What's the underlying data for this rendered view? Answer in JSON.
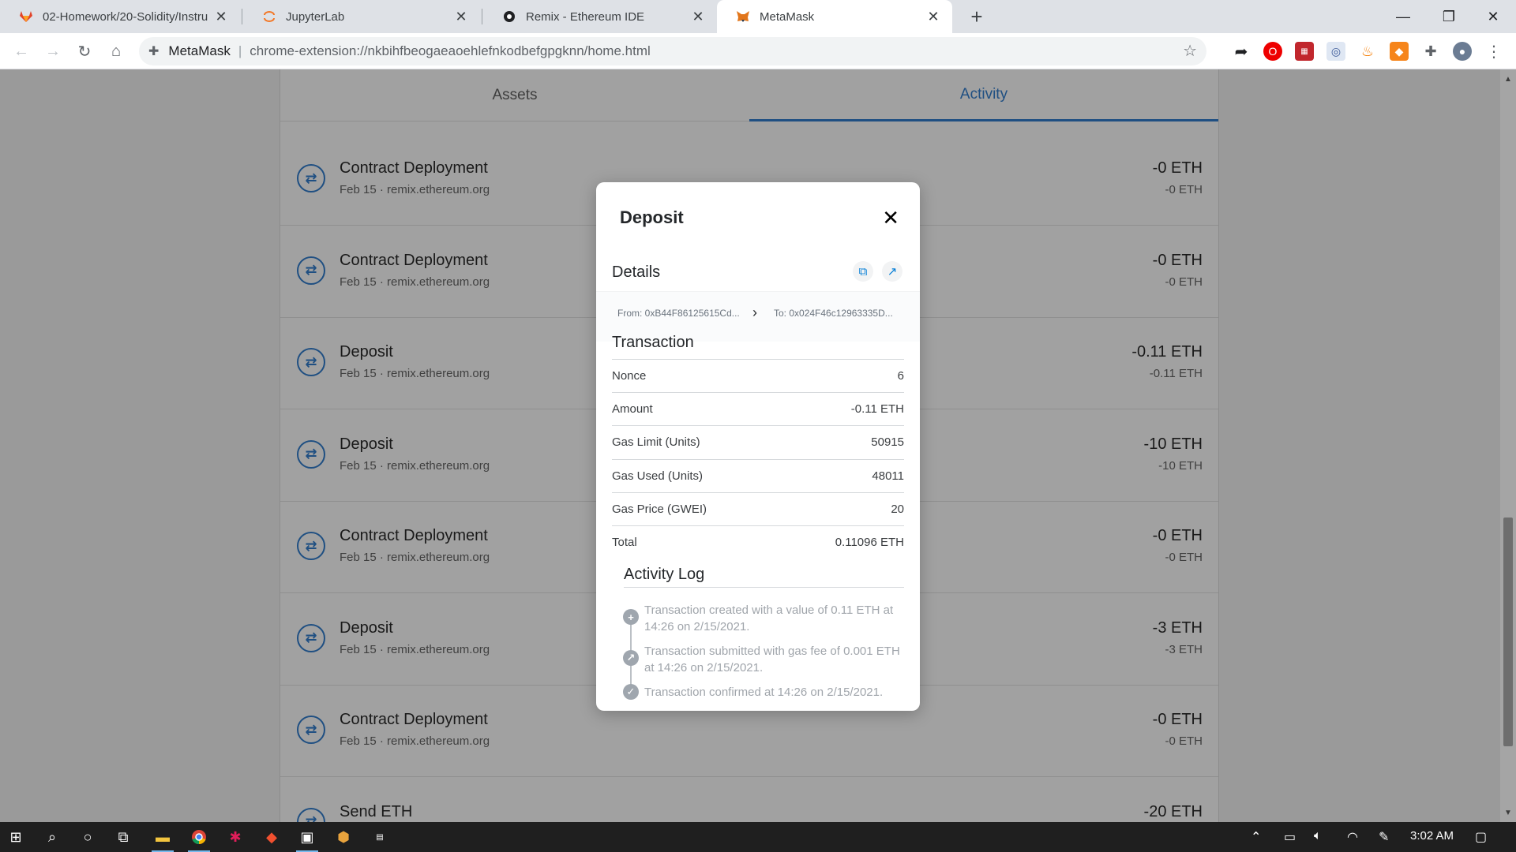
{
  "browser": {
    "tabs": [
      {
        "title": "02-Homework/20-Solidity/Instru",
        "favicon": "gitlab-icon",
        "active": false
      },
      {
        "title": "JupyterLab",
        "favicon": "jupyter-icon",
        "active": false
      },
      {
        "title": "Remix - Ethereum IDE",
        "favicon": "remix-icon",
        "active": false
      },
      {
        "title": "MetaMask",
        "favicon": "metamask-fox-icon",
        "active": true
      }
    ],
    "origin": "MetaMask",
    "url": "chrome-extension://nkbihfbeogaeaoehlefnkodbefgpgknn/home.html"
  },
  "wallet": {
    "tabs": [
      "Assets",
      "Activity"
    ],
    "active_tab": "Activity",
    "transactions": [
      {
        "title": "Contract Deployment",
        "date": "Feb 15",
        "origin": "remix.ethereum.org",
        "amount": "-0 ETH",
        "fiat": "-0 ETH"
      },
      {
        "title": "Contract Deployment",
        "date": "Feb 15",
        "origin": "remix.ethereum.org",
        "amount": "-0 ETH",
        "fiat": "-0 ETH"
      },
      {
        "title": "Deposit",
        "date": "Feb 15",
        "origin": "remix.ethereum.org",
        "amount": "-0.11 ETH",
        "fiat": "-0.11 ETH"
      },
      {
        "title": "Deposit",
        "date": "Feb 15",
        "origin": "remix.ethereum.org",
        "amount": "-10 ETH",
        "fiat": "-10 ETH"
      },
      {
        "title": "Contract Deployment",
        "date": "Feb 15",
        "origin": "remix.ethereum.org",
        "amount": "-0 ETH",
        "fiat": "-0 ETH"
      },
      {
        "title": "Deposit",
        "date": "Feb 15",
        "origin": "remix.ethereum.org",
        "amount": "-3 ETH",
        "fiat": "-3 ETH"
      },
      {
        "title": "Contract Deployment",
        "date": "Feb 15",
        "origin": "remix.ethereum.org",
        "amount": "-0 ETH",
        "fiat": "-0 ETH"
      },
      {
        "title": "Send ETH",
        "date": "",
        "origin": "",
        "amount": "-20 ETH",
        "fiat": ""
      }
    ],
    "separator": "·"
  },
  "modal": {
    "title": "Deposit",
    "details_label": "Details",
    "from": "From: 0xB44F86125615Cd...",
    "to": "To: 0x024F46c12963335D...",
    "transaction_label": "Transaction",
    "rows": [
      {
        "label": "Nonce",
        "value": "6"
      },
      {
        "label": "Amount",
        "value": "-0.11 ETH"
      },
      {
        "label": "Gas Limit (Units)",
        "value": "50915"
      },
      {
        "label": "Gas Used (Units)",
        "value": "48011"
      },
      {
        "label": "Gas Price (GWEI)",
        "value": "20"
      },
      {
        "label": "Total",
        "value": "0.11096 ETH"
      }
    ],
    "activity_log_label": "Activity Log",
    "log": [
      "Transaction created with a value of 0.11 ETH at 14:26 on 2/15/2021.",
      "Transaction submitted with gas fee of 0.001 ETH at 14:26 on 2/15/2021.",
      "Transaction confirmed at 14:26 on 2/15/2021."
    ]
  },
  "taskbar": {
    "time": "3:02 AM"
  },
  "colors": {
    "metamask_blue": "#037dd6",
    "overlay_tab_active": "#1f4f82"
  }
}
